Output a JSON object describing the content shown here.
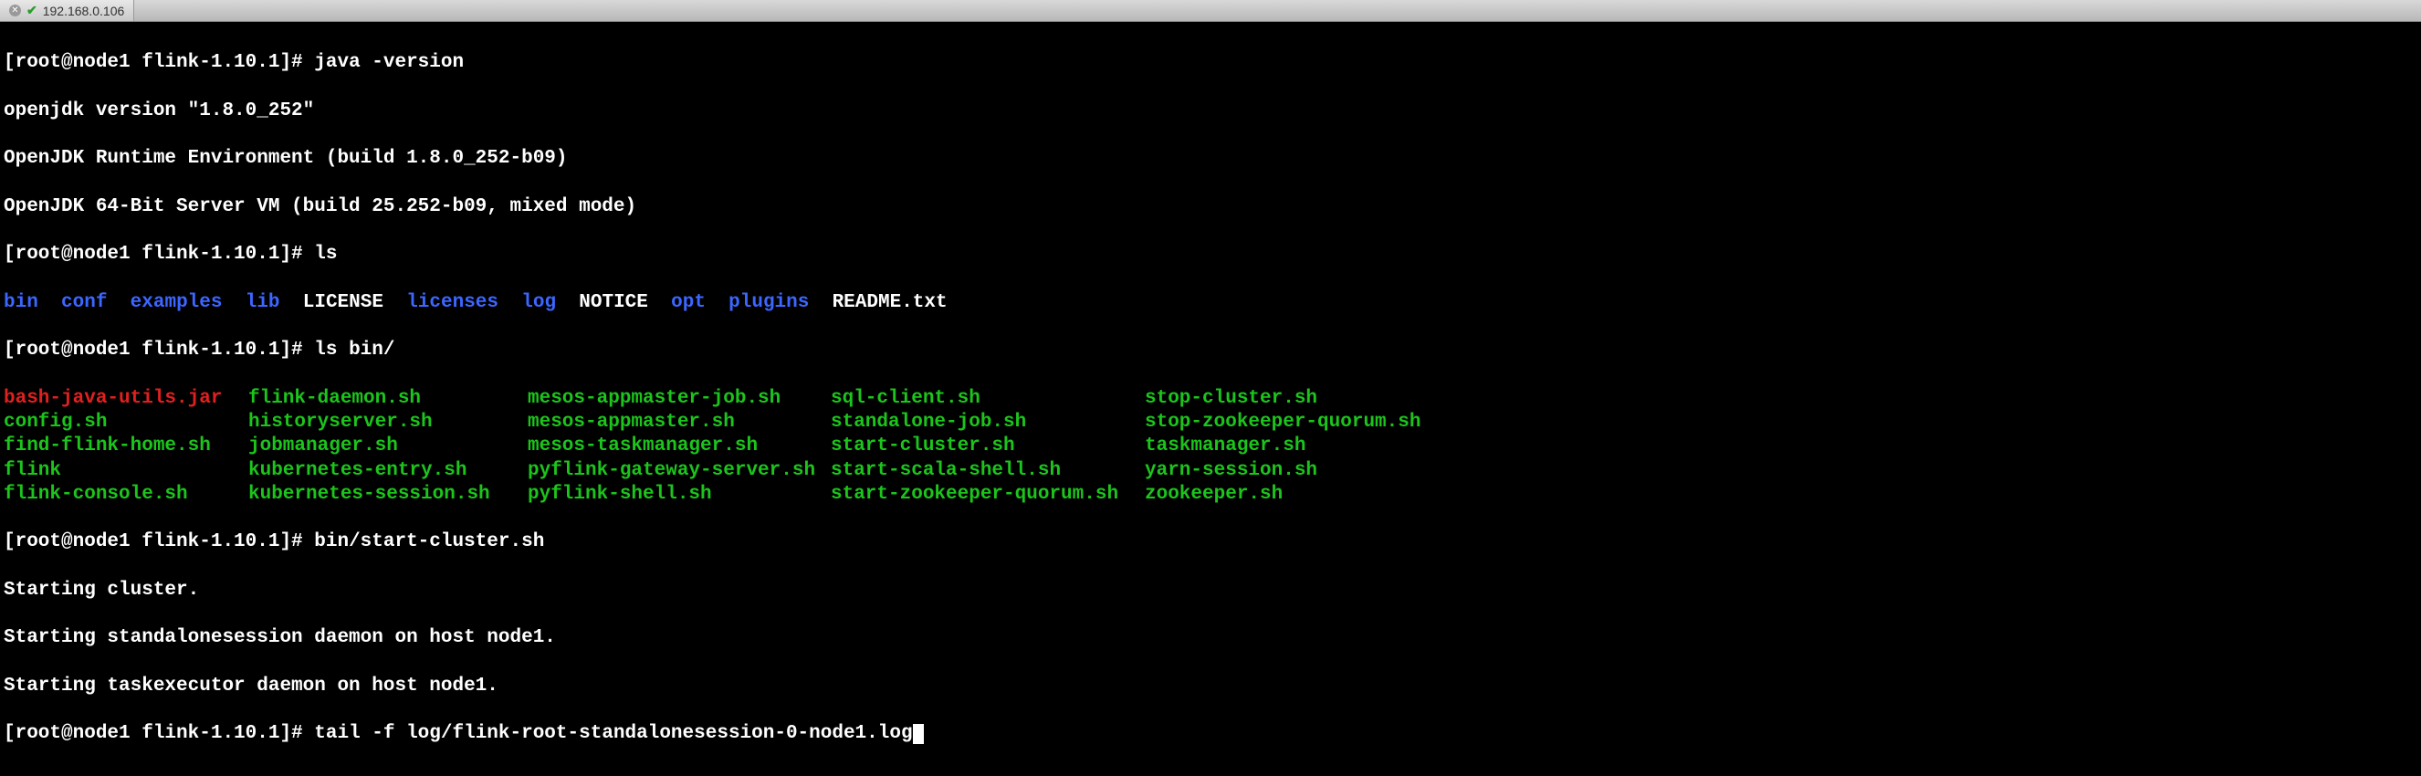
{
  "tab": {
    "title": "192.168.0.106"
  },
  "lines": {
    "prompt": "[root@node1 flink-1.10.1]# ",
    "cmd1": "java -version",
    "out1a": "openjdk version \"1.8.0_252\"",
    "out1b": "OpenJDK Runtime Environment (build 1.8.0_252-b09)",
    "out1c": "OpenJDK 64-Bit Server VM (build 25.252-b09, mixed mode)",
    "cmd2": "ls",
    "ls_items": [
      {
        "name": "bin",
        "cls": "blue"
      },
      {
        "name": "conf",
        "cls": "blue"
      },
      {
        "name": "examples",
        "cls": "blue"
      },
      {
        "name": "lib",
        "cls": "blue"
      },
      {
        "name": "LICENSE",
        "cls": "white"
      },
      {
        "name": "licenses",
        "cls": "blue"
      },
      {
        "name": "log",
        "cls": "blue"
      },
      {
        "name": "NOTICE",
        "cls": "white"
      },
      {
        "name": "opt",
        "cls": "blue"
      },
      {
        "name": "plugins",
        "cls": "blue"
      },
      {
        "name": "README.txt",
        "cls": "white"
      }
    ],
    "cmd3": "ls bin/",
    "bin_grid": [
      [
        {
          "name": "bash-java-utils.jar",
          "cls": "red"
        },
        {
          "name": "flink-daemon.sh",
          "cls": "green"
        },
        {
          "name": "mesos-appmaster-job.sh",
          "cls": "green"
        },
        {
          "name": "sql-client.sh",
          "cls": "green"
        },
        {
          "name": "stop-cluster.sh",
          "cls": "green"
        }
      ],
      [
        {
          "name": "config.sh",
          "cls": "green"
        },
        {
          "name": "historyserver.sh",
          "cls": "green"
        },
        {
          "name": "mesos-appmaster.sh",
          "cls": "green"
        },
        {
          "name": "standalone-job.sh",
          "cls": "green"
        },
        {
          "name": "stop-zookeeper-quorum.sh",
          "cls": "green"
        }
      ],
      [
        {
          "name": "find-flink-home.sh",
          "cls": "green"
        },
        {
          "name": "jobmanager.sh",
          "cls": "green"
        },
        {
          "name": "mesos-taskmanager.sh",
          "cls": "green"
        },
        {
          "name": "start-cluster.sh",
          "cls": "green"
        },
        {
          "name": "taskmanager.sh",
          "cls": "green"
        }
      ],
      [
        {
          "name": "flink",
          "cls": "green"
        },
        {
          "name": "kubernetes-entry.sh",
          "cls": "green"
        },
        {
          "name": "pyflink-gateway-server.sh",
          "cls": "green"
        },
        {
          "name": "start-scala-shell.sh",
          "cls": "green"
        },
        {
          "name": "yarn-session.sh",
          "cls": "green"
        }
      ],
      [
        {
          "name": "flink-console.sh",
          "cls": "green"
        },
        {
          "name": "kubernetes-session.sh",
          "cls": "green"
        },
        {
          "name": "pyflink-shell.sh",
          "cls": "green"
        },
        {
          "name": "start-zookeeper-quorum.sh",
          "cls": "green"
        },
        {
          "name": "zookeeper.sh",
          "cls": "green"
        }
      ]
    ],
    "cmd4": "bin/start-cluster.sh",
    "out4a": "Starting cluster.",
    "out4b": "Starting standalonesession daemon on host node1.",
    "out4c": "Starting taskexecutor daemon on host node1.",
    "cmd5": "tail -f log/flink-root-standalonesession-0-node1.log"
  }
}
